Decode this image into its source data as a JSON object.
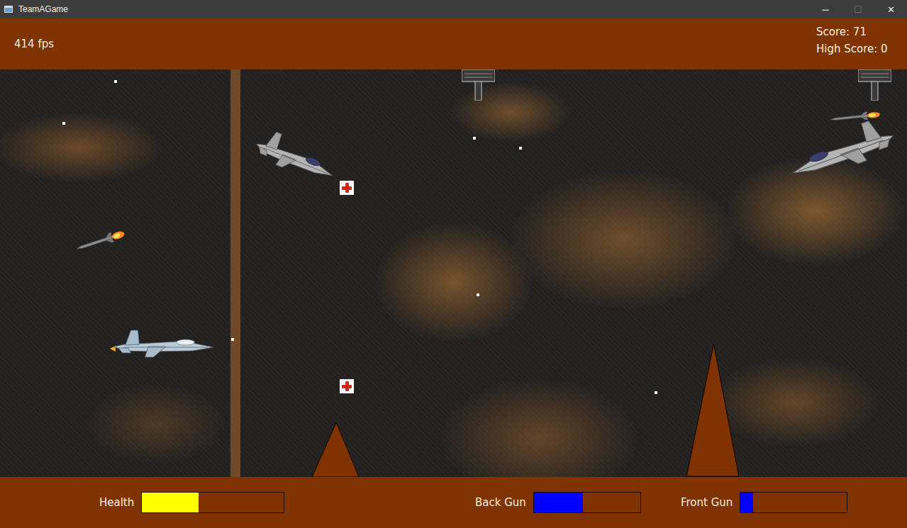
{
  "window": {
    "title": "TeamAGame",
    "controls": [
      {
        "glyph": "─",
        "disabled": false
      },
      {
        "glyph": "☐",
        "disabled": true
      },
      {
        "glyph": "✕",
        "disabled": false
      }
    ]
  },
  "hud": {
    "fps": "414 fps",
    "score": "Score: 71",
    "high_score": "High Score: 0"
  },
  "meters": [
    {
      "label": "Health",
      "level": 0.4,
      "color": "#ffff00"
    },
    {
      "label": "Back Gun",
      "level": 0.46,
      "color": "#0000ff"
    },
    {
      "label": "Front Gun",
      "level": 0.12,
      "color": "#0000ff"
    }
  ],
  "entities": [
    {
      "kind": "player"
    },
    {
      "kind": "enemy"
    },
    {
      "kind": "enemy"
    },
    {
      "kind": "missile"
    },
    {
      "kind": "missile"
    },
    {
      "kind": "health-pack"
    },
    {
      "kind": "health-pack"
    },
    {
      "kind": "turret"
    },
    {
      "kind": "turret"
    },
    {
      "kind": "spike"
    },
    {
      "kind": "spike"
    },
    {
      "kind": "bullet"
    },
    {
      "kind": "bullet"
    },
    {
      "kind": "bullet"
    },
    {
      "kind": "bullet"
    },
    {
      "kind": "bullet"
    },
    {
      "kind": "bullet"
    },
    {
      "kind": "bullet"
    }
  ]
}
